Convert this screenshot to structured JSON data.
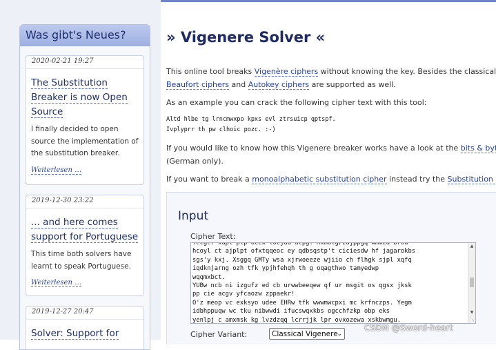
{
  "sidebar": {
    "title": "Was gibt's Neues?",
    "items": [
      {
        "date": "2020-02-21 19:27",
        "title": [
          "The Substitution",
          "Breaker is now Open",
          "Source"
        ],
        "desc": [
          "I finally decided to open",
          "source the implementation of",
          "the substitution breaker."
        ],
        "more": "Weiterlesen …"
      },
      {
        "date": "2019-12-30 23:22",
        "title": [
          "... and here comes",
          "support for Portuguese"
        ],
        "desc": [
          "This time both solvers have",
          "learnt to speak Portuguese."
        ],
        "more": "Weiterlesen …"
      },
      {
        "date": "2019-12-27 20:47",
        "title": [
          "Solver: Support for"
        ],
        "desc": [],
        "more": ""
      }
    ]
  },
  "main": {
    "title": "» Vigenere Solver «",
    "intro": {
      "t1": "This online tool breaks ",
      "l1": "Vigenère ciphers",
      "t2": " without knowing the key. Besides the classical varia",
      "l2": "Beaufort ciphers",
      "t3": " and ",
      "l3": "Autokey ciphers",
      "t4": " are supported as well."
    },
    "example_text": "As an example you can crack the following cipher text with this tool:",
    "cipher_example": [
      "Altd hlbe tg lrncmwxpo kpxs evl ztrsuicp qptspf.",
      "Ivplyprr th pw clhoic pozc. :-)"
    ],
    "breaker_info": {
      "t1": "If you would like to know how this Vigenere breaker works have a look at the ",
      "l1": "bits & bytes co",
      "t2": "(German only)."
    },
    "mono_info": {
      "t1": "If you want to break a ",
      "l1": "monoalphabetic substitution cipher",
      "t2": " instead try the ",
      "l2": "Substitution Solve"
    }
  },
  "input": {
    "heading": "Input",
    "cipher_label": "Cipher Text:",
    "cipher_text": "fccgcr xupl plp ocex locjdu acpg. Mxmolg/zajppgq wmmza brou\nhcoyl ct ajplpt ofxtqqeoc ey qdbsqstp't ciciesdw hf jagarokbs\nsgs'y kxj. Xsggq GMTy wsa xjrwoeeze wjiio ch flhgk sjpl xqfq\niqdknjarng ozh tfk ypjhfehqh th g oqagthwo tamyedwp\nwqqmxbct.\nYUBw ncb ni izgufz ed cb urwwbeeqew qf ur msgit os qgsx jksk\npp cie acgv yfcaozw zppaekr!\nO'z meop vc exksyo udee EHRw tfk wwwmwcpxi mc krfnczps. Yegm\nidbhppuqw wc tku nibwwdi ifucswqxkbs ogcchfzkp obp eks\nyenlpj c amxmsk kg lvzdzqq lcrrjjk lpr ovxozewa xskbwmgu.\nJ'l ...",
    "variant_label": "Cipher Variant:",
    "variant_value": "Classical Vigenere"
  },
  "watermark": "CSDN @Sword-heart",
  "colors": {
    "accent": "#1f2c64",
    "link": "#2542a8",
    "sidebar_header": "#a9b9e8"
  }
}
